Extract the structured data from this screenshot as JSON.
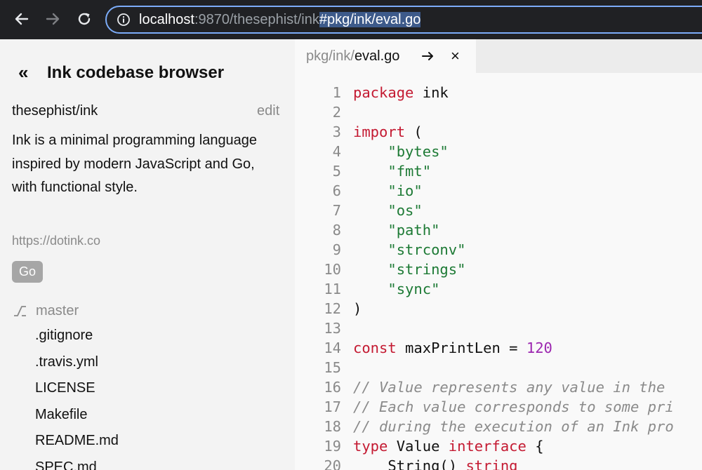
{
  "browser": {
    "url": {
      "host": "localhost",
      "port": ":9870",
      "path": "/thesephist/ink",
      "hash": "#pkg/ink/eval.go"
    }
  },
  "sidebar": {
    "back_glyph": "«",
    "title": "Ink codebase browser",
    "repo_name": "thesephist/ink",
    "edit_label": "edit",
    "description": "Ink is a minimal programming language inspired by modern JavaScript and Go, with functional style.",
    "repo_url": "https://dotink.co",
    "language": "Go",
    "branch": "master",
    "files": [
      ".gitignore",
      ".travis.yml",
      "LICENSE",
      "Makefile",
      "README.md",
      "SPEC.md"
    ]
  },
  "editor": {
    "tab": {
      "dir": "pkg/ink/",
      "file": "eval.go",
      "close_glyph": "×"
    },
    "lines": [
      {
        "n": "1",
        "tokens": [
          {
            "t": "package",
            "c": "kw"
          },
          {
            "t": " ink",
            "c": ""
          }
        ]
      },
      {
        "n": "2",
        "tokens": []
      },
      {
        "n": "3",
        "tokens": [
          {
            "t": "import",
            "c": "kw"
          },
          {
            "t": " (",
            "c": ""
          }
        ]
      },
      {
        "n": "4",
        "tokens": [
          {
            "t": "    ",
            "c": ""
          },
          {
            "t": "\"bytes\"",
            "c": "str"
          }
        ]
      },
      {
        "n": "5",
        "tokens": [
          {
            "t": "    ",
            "c": ""
          },
          {
            "t": "\"fmt\"",
            "c": "str"
          }
        ]
      },
      {
        "n": "6",
        "tokens": [
          {
            "t": "    ",
            "c": ""
          },
          {
            "t": "\"io\"",
            "c": "str"
          }
        ]
      },
      {
        "n": "7",
        "tokens": [
          {
            "t": "    ",
            "c": ""
          },
          {
            "t": "\"os\"",
            "c": "str"
          }
        ]
      },
      {
        "n": "8",
        "tokens": [
          {
            "t": "    ",
            "c": ""
          },
          {
            "t": "\"path\"",
            "c": "str"
          }
        ]
      },
      {
        "n": "9",
        "tokens": [
          {
            "t": "    ",
            "c": ""
          },
          {
            "t": "\"strconv\"",
            "c": "str"
          }
        ]
      },
      {
        "n": "10",
        "tokens": [
          {
            "t": "    ",
            "c": ""
          },
          {
            "t": "\"strings\"",
            "c": "str"
          }
        ]
      },
      {
        "n": "11",
        "tokens": [
          {
            "t": "    ",
            "c": ""
          },
          {
            "t": "\"sync\"",
            "c": "str"
          }
        ]
      },
      {
        "n": "12",
        "tokens": [
          {
            "t": ")",
            "c": ""
          }
        ]
      },
      {
        "n": "13",
        "tokens": []
      },
      {
        "n": "14",
        "tokens": [
          {
            "t": "const",
            "c": "kw"
          },
          {
            "t": " maxPrintLen = ",
            "c": ""
          },
          {
            "t": "120",
            "c": "num"
          }
        ]
      },
      {
        "n": "15",
        "tokens": []
      },
      {
        "n": "16",
        "tokens": [
          {
            "t": "// Value represents any value in the",
            "c": "cmt"
          }
        ]
      },
      {
        "n": "17",
        "tokens": [
          {
            "t": "// Each value corresponds to some pri",
            "c": "cmt"
          }
        ]
      },
      {
        "n": "18",
        "tokens": [
          {
            "t": "// during the execution of an Ink pro",
            "c": "cmt"
          }
        ]
      },
      {
        "n": "19",
        "tokens": [
          {
            "t": "type",
            "c": "kw"
          },
          {
            "t": " Value ",
            "c": ""
          },
          {
            "t": "interface",
            "c": "kw"
          },
          {
            "t": " {",
            "c": ""
          }
        ]
      },
      {
        "n": "20",
        "tokens": [
          {
            "t": "    String() ",
            "c": ""
          },
          {
            "t": "string",
            "c": "kw"
          }
        ]
      }
    ]
  },
  "colors": {
    "chrome_bg": "#202124",
    "omnibox_border": "#7cacf8",
    "keyword": "#c41a32",
    "string": "#1d7a35",
    "number": "#9c27b0",
    "comment": "#8a8a8a"
  }
}
